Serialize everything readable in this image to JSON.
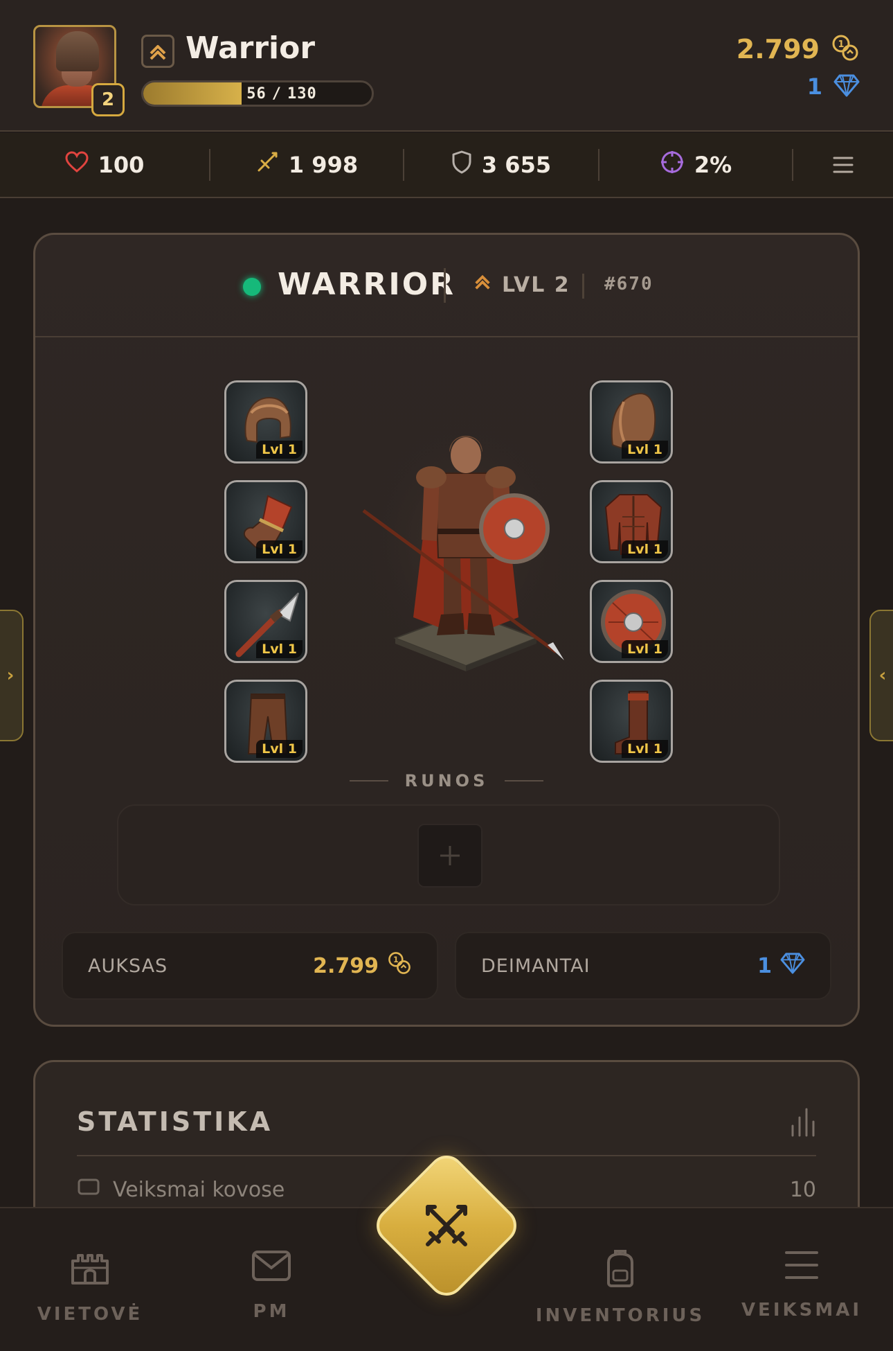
{
  "header": {
    "player_name": "Warrior",
    "avatar_level": "2",
    "xp_current": "56",
    "xp_separator": "/",
    "xp_max": "130",
    "xp_fraction": 0.43,
    "gold": "2.799",
    "gems": "1"
  },
  "stats_bar": {
    "health": "100",
    "attack": "1 998",
    "defense": "3 655",
    "crit": "2%"
  },
  "character": {
    "title": "WARRIOR",
    "level": "LVL 2",
    "rank": "#670",
    "status_color": "#16b97a",
    "equipment_left": [
      {
        "item": "helmet",
        "level": "Lvl 1"
      },
      {
        "item": "gauntlet",
        "level": "Lvl 1"
      },
      {
        "item": "spear",
        "level": "Lvl 1"
      },
      {
        "item": "pants",
        "level": "Lvl 1"
      }
    ],
    "equipment_right": [
      {
        "item": "shoulder-pad",
        "level": "Lvl 1"
      },
      {
        "item": "armor-jacket",
        "level": "Lvl 1"
      },
      {
        "item": "round-shield",
        "level": "Lvl 1"
      },
      {
        "item": "boots",
        "level": "Lvl 1"
      }
    ],
    "runes_label": "RUNOS",
    "currency": {
      "gold_label": "AUKSAS",
      "gold_value": "2.799",
      "gems_label": "DEIMANTAI",
      "gems_value": "1"
    }
  },
  "statistics": {
    "title": "STATISTIKA",
    "first_row_label": "Veiksmai kovose",
    "first_row_value": "10"
  },
  "bottom_nav": {
    "items": [
      {
        "label": "VIETOVĖ",
        "icon": "castle-icon"
      },
      {
        "label": "PM",
        "icon": "mail-icon"
      },
      {
        "label": "INVENTORIUS",
        "icon": "backpack-icon"
      },
      {
        "label": "VEIKSMAI",
        "icon": "menu-icon"
      }
    ],
    "center_icon": "crossed-swords-icon"
  },
  "colors": {
    "gold": "#e1b552",
    "gem_blue": "#4b8fe0",
    "accent_gold": "#d8ae3f"
  }
}
